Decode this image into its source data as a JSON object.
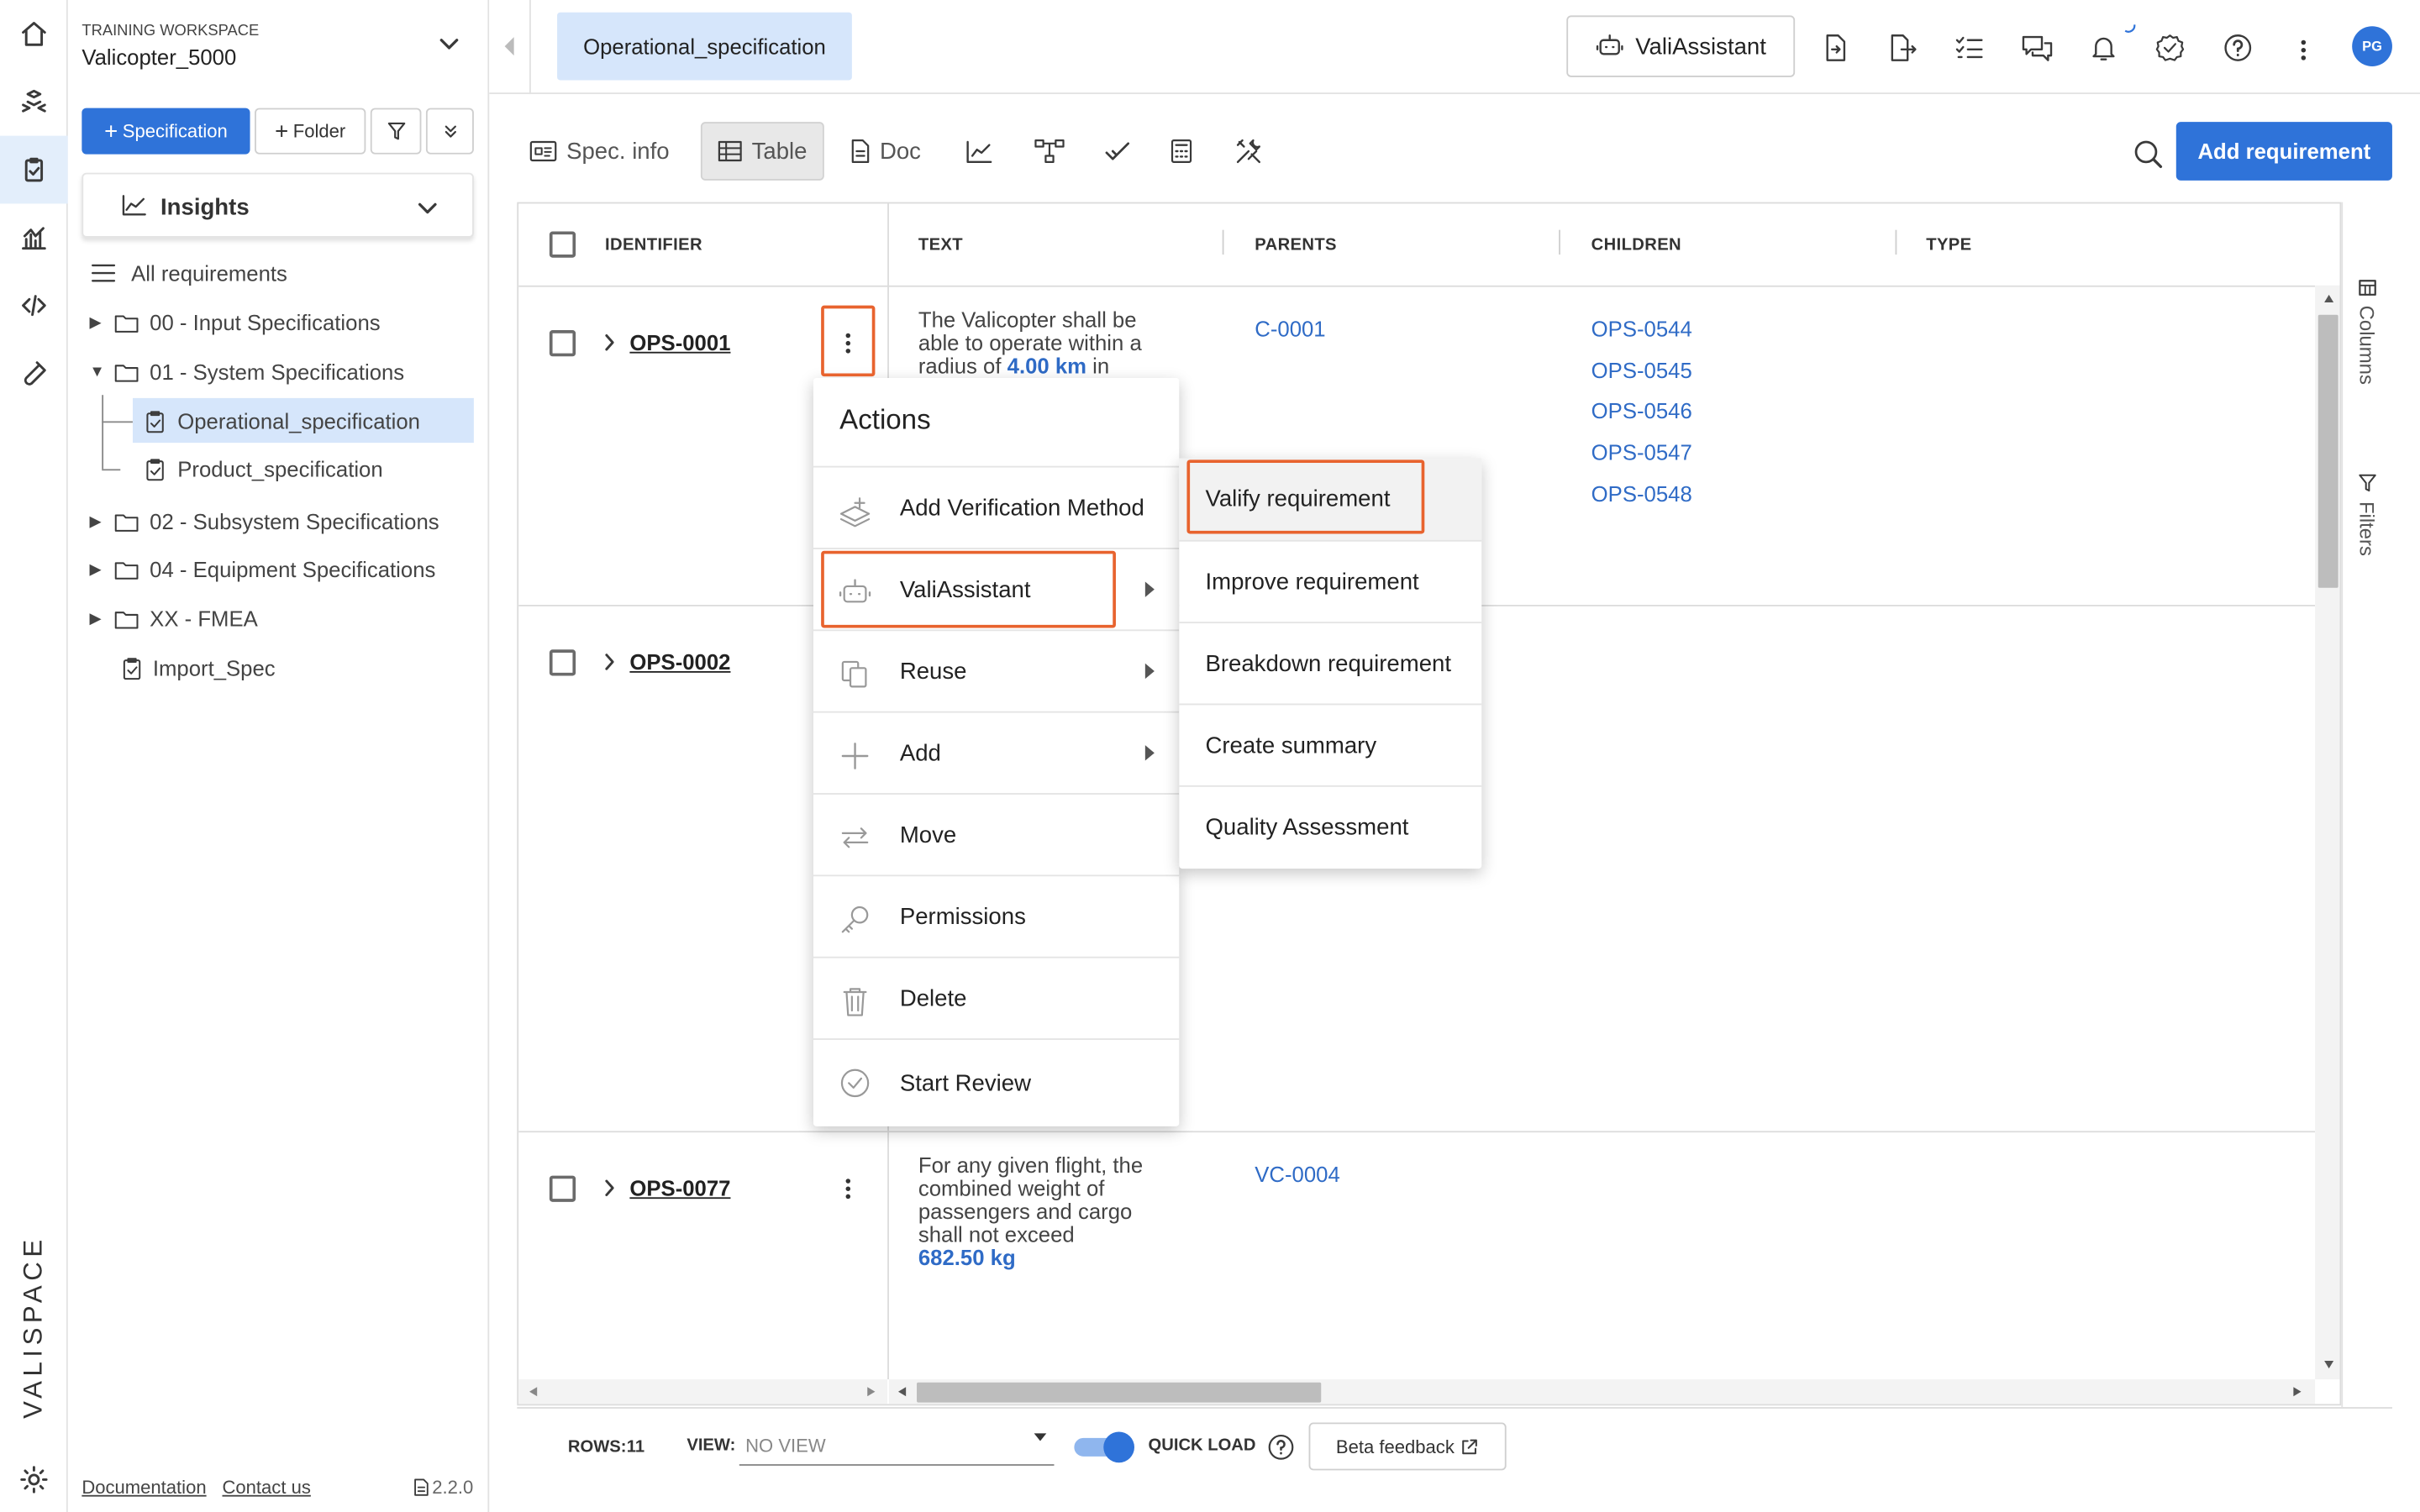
{
  "workspace": {
    "label": "TRAINING WORKSPACE",
    "name": "Valicopter_5000"
  },
  "sidebar": {
    "spec_button": "Specification",
    "folder_button": "Folder",
    "insights": "Insights",
    "tree": [
      {
        "label": "All requirements"
      },
      {
        "label": "00 - Input Specifications"
      },
      {
        "label": "01 - System Specifications"
      },
      {
        "label": "Operational_specification"
      },
      {
        "label": "Product_specification"
      },
      {
        "label": "02 - Subsystem Specifications"
      },
      {
        "label": "04 - Equipment Specifications"
      },
      {
        "label": "XX - FMEA"
      },
      {
        "label": "Import_Spec"
      }
    ],
    "footer": {
      "documentation": "Documentation",
      "contact": "Contact us",
      "version": "2.2.0"
    }
  },
  "brand": "VALISPACE",
  "topbar": {
    "active_tab": "Operational_specification",
    "assistant_button": "ValiAssistant",
    "avatar": "PG"
  },
  "toolbar": {
    "spec_info": "Spec. info",
    "table": "Table",
    "doc": "Doc",
    "add_requirement": "Add requirement"
  },
  "table": {
    "columns": [
      "IDENTIFIER",
      "TEXT",
      "PARENTS",
      "CHILDREN",
      "TYPE"
    ],
    "rows": [
      {
        "id": "OPS-0001",
        "text_a": "The Valicopter shall be able to operate within a radius of ",
        "value": "4.00",
        "unit": "km",
        "text_b": " in",
        "parent": "C-0001",
        "children": [
          "OPS-0544",
          "OPS-0545",
          "OPS-0546",
          "OPS-0547",
          "OPS-0548"
        ]
      },
      {
        "id": "OPS-0002"
      },
      {
        "id": "OPS-0077",
        "text_a": "For any given flight, the combined weight of passengers and cargo shall not exceed",
        "value": "682.50",
        "unit": "kg",
        "parent": "VC-0004"
      }
    ]
  },
  "side_panel": {
    "columns": "Columns",
    "filters": "Filters"
  },
  "bottom": {
    "rows_label": "ROWS:",
    "rows_value": "11",
    "view_label": "VIEW:",
    "view_value": "NO VIEW",
    "quick_load": "QUICK LOAD",
    "beta_feedback": "Beta feedback"
  },
  "menu": {
    "title": "Actions",
    "items": [
      "Add Verification Method",
      "ValiAssistant",
      "Reuse",
      "Add",
      "Move",
      "Permissions",
      "Delete",
      "Start Review"
    ]
  },
  "submenu": {
    "items": [
      "Valify requirement",
      "Improve requirement",
      "Breakdown requirement",
      "Create summary",
      "Quality Assessment"
    ]
  },
  "colors": {
    "accent": "#2f73d9",
    "highlight": "#e8632e",
    "selected_bg": "#d6e6fb"
  }
}
